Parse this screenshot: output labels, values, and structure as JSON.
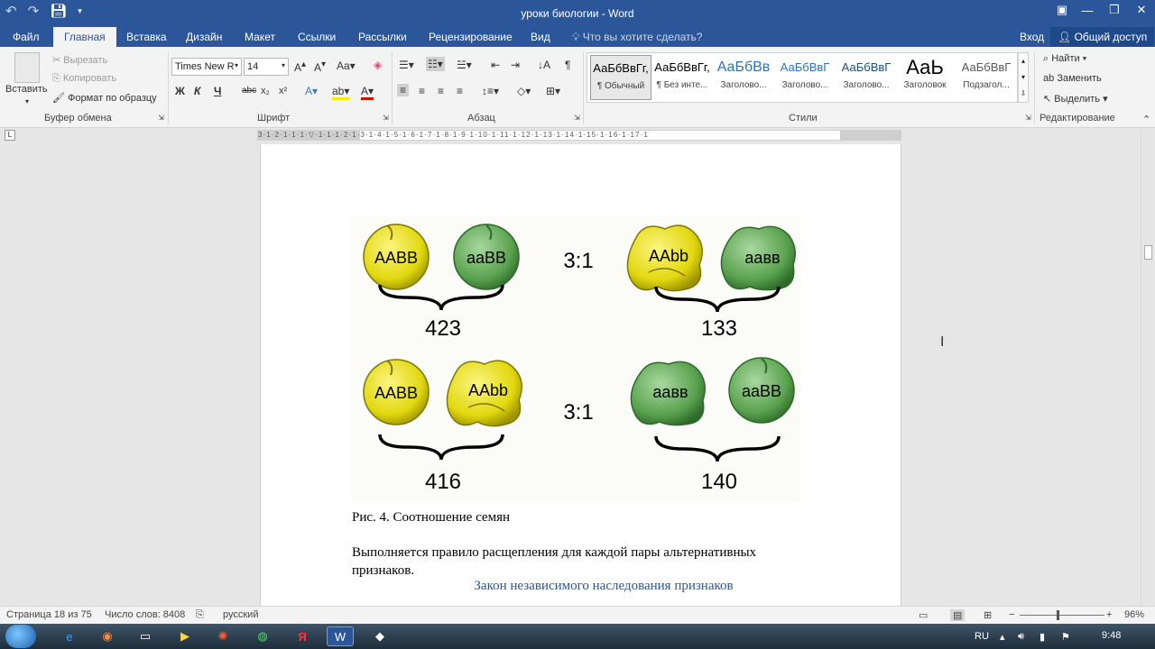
{
  "app": {
    "title": "уроки биологии - Word"
  },
  "qat": {
    "undo_icon": "undo-icon",
    "redo_icon": "redo-icon",
    "save_icon": "save-icon",
    "customize_icon": "chevron-down-icon"
  },
  "window_controls": {
    "ribbon_options": "▣",
    "minimize": "—",
    "restore": "❐",
    "close": "✕"
  },
  "tabs": [
    {
      "label": "Файл"
    },
    {
      "label": "Главная"
    },
    {
      "label": "Вставка"
    },
    {
      "label": "Дизайн"
    },
    {
      "label": "Макет"
    },
    {
      "label": "Ссылки"
    },
    {
      "label": "Рассылки"
    },
    {
      "label": "Рецензирование"
    },
    {
      "label": "Вид"
    }
  ],
  "tellme": "Что вы хотите сделать?",
  "signin": "Вход",
  "share": "Общий доступ",
  "clipboard": {
    "paste": "Вставить",
    "cut": "Вырезать",
    "copy": "Копировать",
    "format_painter": "Формат по образцу",
    "label": "Буфер обмена"
  },
  "font": {
    "name": "Times New R",
    "size": "14",
    "label": "Шрифт",
    "bold": "Ж",
    "italic": "К",
    "underline": "Ч"
  },
  "paragraph": {
    "label": "Абзац"
  },
  "styles": {
    "label": "Стили",
    "items": [
      {
        "preview": "АаБбВвГг,",
        "name": "¶ Обычный"
      },
      {
        "preview": "АаБбВвГг,",
        "name": "¶ Без инте..."
      },
      {
        "preview": "АаБбВв",
        "name": "Заголово..."
      },
      {
        "preview": "АаБбВвГ",
        "name": "Заголово..."
      },
      {
        "preview": "АаБбВвГ",
        "name": "Заголово..."
      },
      {
        "preview": "АаЬ",
        "name": "Заголовок"
      },
      {
        "preview": "АаБбВвГ",
        "name": "Подзагол..."
      }
    ]
  },
  "editing": {
    "label": "Редактирование",
    "find": "Найти",
    "replace": "Заменить",
    "select": "Выделить"
  },
  "figure": {
    "top_ratio": "3:1",
    "bottom_ratio": "3:1",
    "top_left_count": "423",
    "top_right_count": "133",
    "bottom_left_count": "416",
    "bottom_right_count": "140",
    "seeds": {
      "t1": "AABB",
      "t2": "aaBB",
      "t3": "AAbb",
      "t4": "aaвв",
      "b1": "AABB",
      "b2": "AAbb",
      "b3": "aaвв",
      "b4": "aaBB"
    }
  },
  "document": {
    "caption": "Рис. 4. Соотношение семян",
    "paragraph": "Выполняется правило расщепления для каждой пары альтернативных признаков.",
    "heading": "Закон независимого наследования признаков"
  },
  "statusbar": {
    "page": "Страница 18 из 75",
    "words": "Число слов: 8408",
    "language": "русский",
    "zoom": "96%"
  },
  "taskbar": {
    "lang": "RU",
    "time": "9:48"
  }
}
